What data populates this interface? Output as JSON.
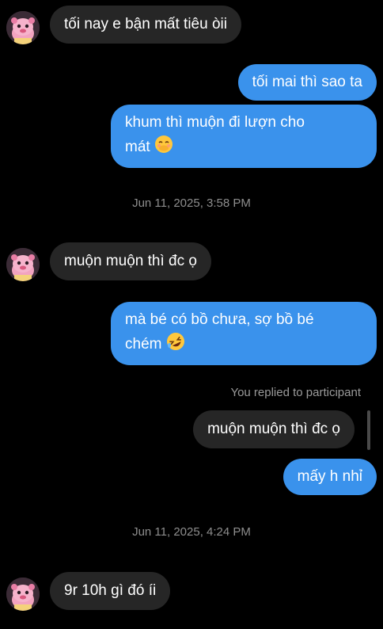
{
  "messages": {
    "m1": "tối nay e bận mất tiêu òii",
    "m2": "tối mai thì sao ta",
    "m3_line1": "khum thì muộn đi lượn cho",
    "m3_line2": "mát",
    "ts1": "Jun 11, 2025, 3:58 PM",
    "m4": "muộn muộn thì đc ọ",
    "m5_line1": "mà bé có bồ chưa, sợ bồ bé",
    "m5_line2": "chém",
    "reply_label": "You replied to participant",
    "quoted": "muộn muộn thì đc ọ",
    "m6": "mấy h nhỉ",
    "ts2": "Jun 11, 2025, 4:24 PM",
    "m7": "9r 10h gì đó íi"
  },
  "icons": {
    "avatar": "pink-axolotl-avatar",
    "emoji_blush": "smiling-face-with-hand-over-mouth-emoji",
    "emoji_laugh": "rolling-on-floor-laughing-emoji"
  },
  "colors": {
    "background": "#000000",
    "incoming_bubble": "#262626",
    "outgoing_bubble": "#3a92ec",
    "timestamp": "#8e8e8e"
  }
}
